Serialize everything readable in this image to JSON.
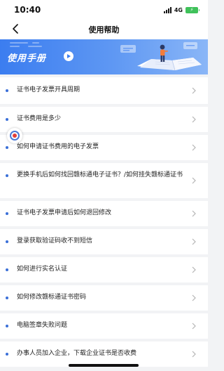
{
  "status_bar": {
    "time": "10:40",
    "network": "4G"
  },
  "nav": {
    "title": "使用帮助"
  },
  "banner": {
    "title": "使用手册"
  },
  "faq": [
    {
      "text": "证书电子发票开具周期"
    },
    {
      "text": "证书费用是多少"
    },
    {
      "text": "如何申请证书费用的电子发票"
    },
    {
      "text": "更换手机后如何找回赣标通电子证书？/如何挂失赣标通证书"
    },
    {
      "text": "证书电子发票申请后如何退回修改"
    },
    {
      "text": "登录获取验证码收不到短信"
    },
    {
      "text": "如何进行实名认证"
    },
    {
      "text": "如何修改赣标通证书密码"
    },
    {
      "text": "电脑签章失败问题"
    },
    {
      "text": "办事人员加入企业，下载企业证书是否收费"
    }
  ],
  "icons": {
    "back": "chevron-left-icon",
    "item": "chevron-right-icon",
    "dot": "bullet-dot-icon"
  },
  "colors": {
    "accent": "#3b7df0",
    "dot": "#3a6fd8",
    "background": "#f2f3f5"
  }
}
